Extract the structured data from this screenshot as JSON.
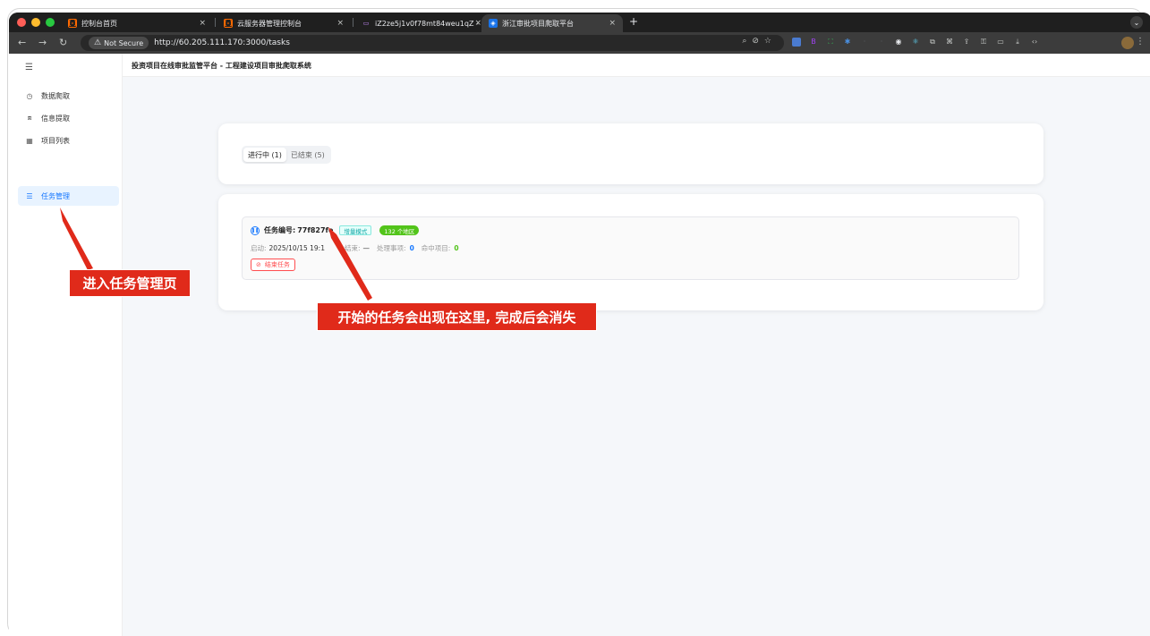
{
  "browser": {
    "tabs": [
      {
        "title": "控制台首页",
        "favicon": "aliyun-icon",
        "active": false
      },
      {
        "title": "云服务器管理控制台",
        "favicon": "aliyun-icon",
        "active": false
      },
      {
        "title": "iZ2ze5j1v0f78mt84weu1qZ -",
        "favicon": "terminal-icon",
        "active": false
      },
      {
        "title": "浙江审批项目爬取平台",
        "favicon": "app-icon",
        "active": true
      }
    ],
    "close_glyph": "×",
    "new_tab_glyph": "+",
    "security_label": "Not Secure",
    "url": "http://60.205.111.170:3000/tasks"
  },
  "sidebar": {
    "items": [
      {
        "label": "数据爬取",
        "icon": "clock-icon",
        "active": false
      },
      {
        "label": "信息提取",
        "icon": "document-search-icon",
        "active": false
      },
      {
        "label": "项目列表",
        "icon": "table-icon",
        "active": false
      },
      {
        "label": "任务管理",
        "icon": "list-icon",
        "active": true
      }
    ]
  },
  "header": {
    "title": "投资项目在线审批监管平台 - 工程建设项目审批爬取系统"
  },
  "tasks_page": {
    "tabs": [
      {
        "label": "进行中 (1)",
        "active": true
      },
      {
        "label": "已结束 (5)",
        "active": false
      }
    ],
    "task": {
      "id_label": "任务编号:",
      "id": "77f827fe",
      "mode_tag": "增量模式",
      "region_tag": "132 个地区",
      "start_label": "启动:",
      "start_value": "2025/10/15 19:1",
      "end_label": "结束:",
      "end_value": "—",
      "processed_label": "处理事项:",
      "processed_value": "0",
      "hits_label": "命中项目:",
      "hits_value": "0",
      "end_button": "结束任务"
    }
  },
  "annotations": {
    "sidebar_note": "进入任务管理页",
    "task_note": "开始的任务会出现在这里, 完成后会消失"
  },
  "colors": {
    "accent": "#1677ff",
    "annotation": "#e02a1a",
    "success": "#52c41a",
    "danger": "#ff4d4f"
  }
}
